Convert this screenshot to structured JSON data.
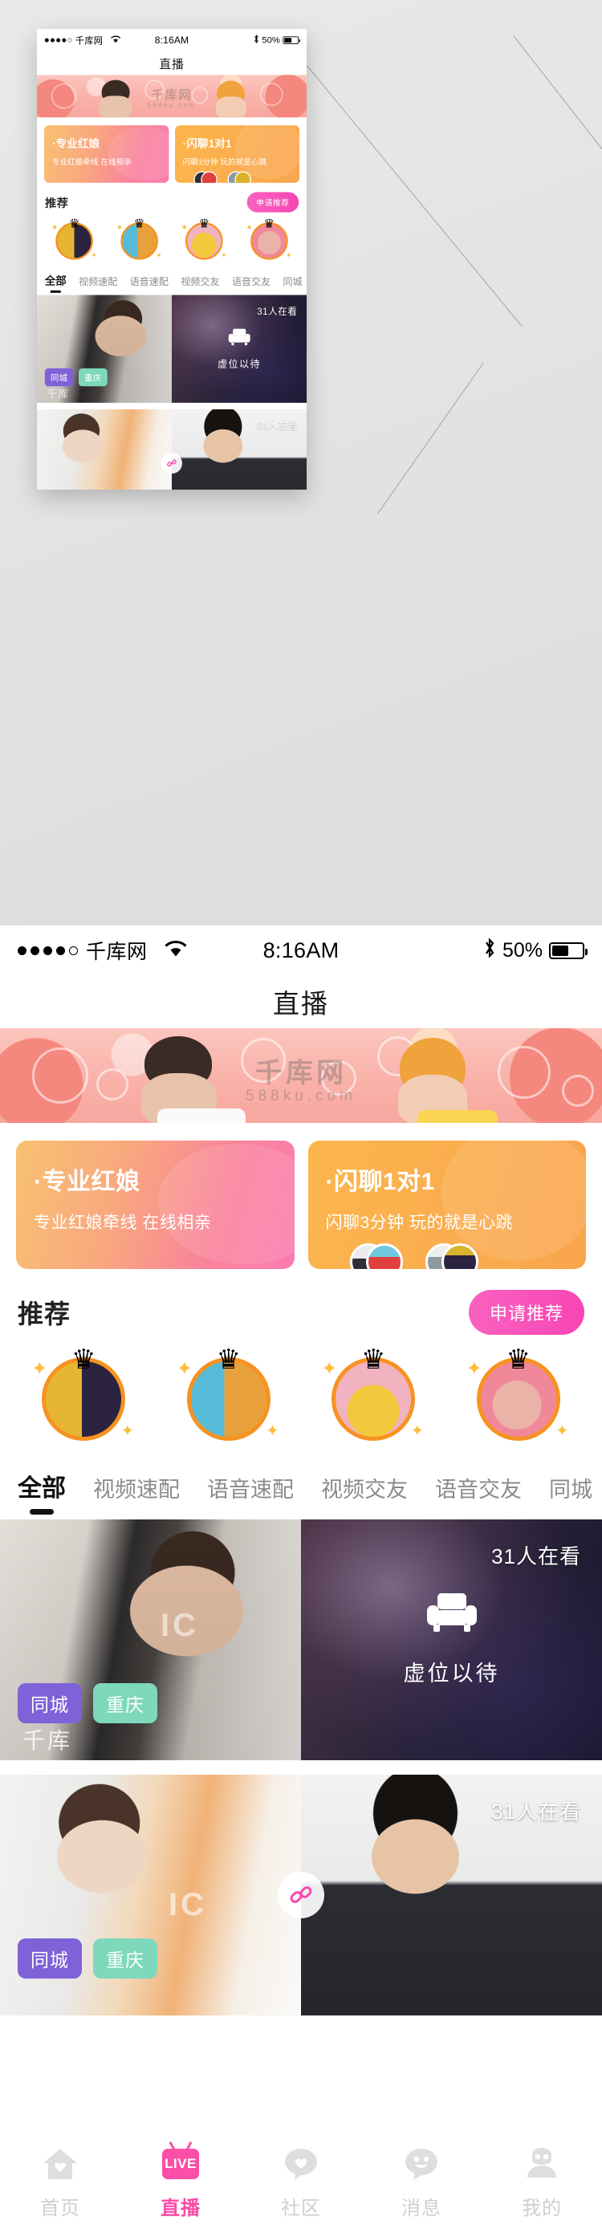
{
  "statusbar": {
    "carrier": "千库网",
    "time": "8:16AM",
    "battery_percent": "50%",
    "signal_dots": 5,
    "signal_filled": 4,
    "wifi_icon": "wifi-icon",
    "bluetooth_icon": "bluetooth-icon",
    "battery_icon": "battery-icon"
  },
  "header": {
    "title": "直播"
  },
  "banner": {
    "watermark": "千库网",
    "watermark_sub": "588ku.com",
    "alt": "illustrated couple on pink heart background"
  },
  "feature_cards": [
    {
      "title": "·专业红娘",
      "subtitle": "专业红娘牵线  在线相亲",
      "accent": "#f9829b",
      "gradient_from": "#f8c171",
      "gradient_to": "#fa7cb0",
      "has_avatars": false
    },
    {
      "title": "·闪聊1对1",
      "subtitle": "闪聊3分钟  玩的就是心跳",
      "accent": "#f9a54d",
      "gradient_from": "#fcb64e",
      "gradient_to": "#f9a54d",
      "has_avatars": true
    }
  ],
  "recommend": {
    "title": "推荐",
    "apply_label": "申请推荐",
    "apply_color": "#f645b4",
    "crown_icon": "crown-icon",
    "sparkle_icon": "sparkle-icon",
    "avatars": [
      {
        "name": "avatar-1",
        "bg": "#e6b531",
        "fg": "#2b2340"
      },
      {
        "name": "avatar-2",
        "bg": "#58bcd8",
        "fg": "#e8413f"
      },
      {
        "name": "avatar-3",
        "bg": "#f0b3bf",
        "fg": "#f2c93d"
      },
      {
        "name": "avatar-4",
        "bg": "#f0889a",
        "fg": "#e8a8a2"
      }
    ]
  },
  "tabs": {
    "active_index": 0,
    "items": [
      {
        "label": "全部"
      },
      {
        "label": "视频速配"
      },
      {
        "label": "语音速配"
      },
      {
        "label": "视频交友"
      },
      {
        "label": "语音交友"
      },
      {
        "label": "同城"
      }
    ]
  },
  "live_cards": [
    {
      "viewers": "31人在看",
      "empty_label": "虚位以待",
      "empty_icon": "armchair-icon",
      "watermark": "千库",
      "tags": [
        {
          "label": "同城",
          "color": "#7f62d8"
        },
        {
          "label": "重庆",
          "color": "#7ed8bc"
        }
      ]
    },
    {
      "viewers": "31人在看",
      "link_icon": "link-chain-icon",
      "link_color": "#f946ae",
      "tags": [
        {
          "label": "同城",
          "color": "#7f62d8"
        },
        {
          "label": "重庆",
          "color": "#7ed8bc"
        }
      ]
    }
  ],
  "tabbar": {
    "active_index": 1,
    "active_color": "#f94ba6",
    "inactive_color": "#cfcfcf",
    "items": [
      {
        "label": "首页",
        "icon": "home-heart-icon"
      },
      {
        "label": "直播",
        "icon": "live-tv-icon"
      },
      {
        "label": "社区",
        "icon": "community-heart-icon"
      },
      {
        "label": "消息",
        "icon": "message-smile-icon"
      },
      {
        "label": "我的",
        "icon": "profile-person-icon"
      }
    ]
  }
}
